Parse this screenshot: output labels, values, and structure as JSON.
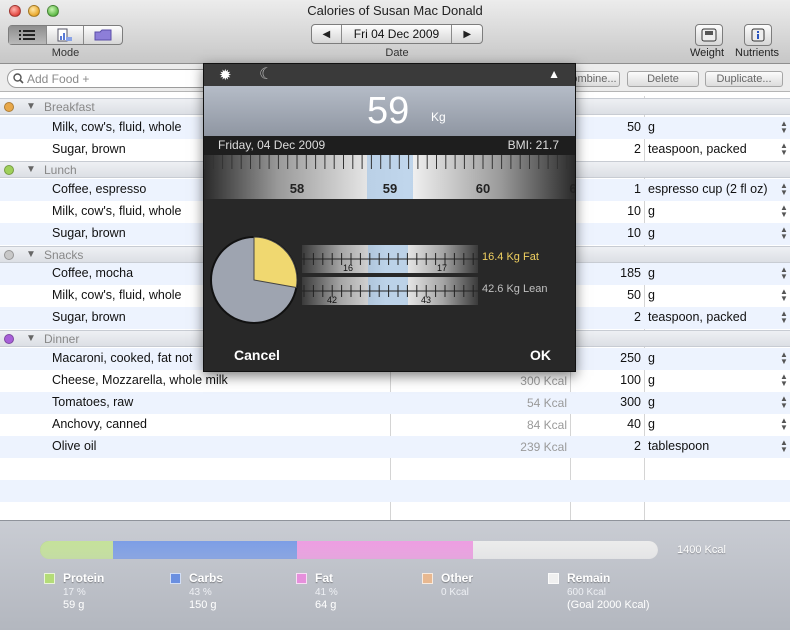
{
  "window": {
    "title": "Calories of Susan Mac Donald"
  },
  "toolbar": {
    "mode_label": "Mode",
    "mode_icons": [
      "list-icon",
      "chart-icon",
      "folder-icon"
    ],
    "date_value": "Fri 04 Dec 2009",
    "date_label": "Date",
    "prev_arrow": "◀",
    "next_arrow": "▶",
    "weight_label": "Weight",
    "nutrients_label": "Nutrients"
  },
  "search": {
    "placeholder": "Add Food +",
    "combine_label": "Combine...",
    "delete_label": "Delete",
    "duplicate_label": "Duplicate..."
  },
  "groups": [
    {
      "name": "Breakfast",
      "color": "#e8a84a"
    },
    {
      "name": "Lunch",
      "color": "#9fd05a"
    },
    {
      "name": "Snacks",
      "color": "#c8c8c8"
    },
    {
      "name": "Dinner",
      "color": "#a860d8"
    }
  ],
  "items": [
    {
      "name": "Milk, cow's, fluid, whole",
      "kcal": "",
      "qty": "50",
      "unit": "g"
    },
    {
      "name": "Sugar, brown",
      "kcal": "",
      "qty": "2",
      "unit": "teaspoon, packed"
    },
    {
      "name": "Coffee, espresso",
      "kcal": "",
      "qty": "1",
      "unit": "espresso cup (2 fl oz)"
    },
    {
      "name": "Milk, cow's, fluid, whole",
      "kcal": "",
      "qty": "10",
      "unit": "g"
    },
    {
      "name": "Sugar, brown",
      "kcal": "",
      "qty": "10",
      "unit": "g"
    },
    {
      "name": "Coffee, mocha",
      "kcal": "",
      "qty": "185",
      "unit": "g"
    },
    {
      "name": "Milk, cow's, fluid, whole",
      "kcal": "",
      "qty": "50",
      "unit": "g"
    },
    {
      "name": "Sugar, brown",
      "kcal": "",
      "qty": "2",
      "unit": "teaspoon, packed"
    },
    {
      "name": "Macaroni, cooked, fat not",
      "kcal": "",
      "qty": "250",
      "unit": "g"
    },
    {
      "name": "Cheese, Mozzarella, whole milk",
      "kcal": "300 Kcal",
      "qty": "100",
      "unit": "g"
    },
    {
      "name": "Tomatoes, raw",
      "kcal": "54 Kcal",
      "qty": "300",
      "unit": "g"
    },
    {
      "name": "Anchovy, canned",
      "kcal": "84 Kcal",
      "qty": "40",
      "unit": "g"
    },
    {
      "name": "Olive oil",
      "kcal": "239 Kcal",
      "qty": "2",
      "unit": "tablespoon"
    }
  ],
  "summary": {
    "total": "1400 Kcal",
    "segments": [
      {
        "name": "protein",
        "fraction": 0.17,
        "color": "#c5e29a"
      },
      {
        "name": "carbs",
        "fraction": 0.43,
        "color": "#7d9ee6"
      },
      {
        "name": "fat",
        "fraction": 0.41,
        "color": "#ee9ee2"
      },
      {
        "name": "remain",
        "fraction": 0.43,
        "color": "#ececec"
      }
    ],
    "protein": {
      "name": "Protein",
      "pct": "17 %",
      "val": "59 g",
      "color": "#b4dc78"
    },
    "carbs": {
      "name": "Carbs",
      "pct": "43 %",
      "val": "150 g",
      "color": "#6a8fe0"
    },
    "fat": {
      "name": "Fat",
      "pct": "41 %",
      "val": "64 g",
      "color": "#e690dc"
    },
    "other": {
      "name": "Other",
      "val": "0 Kcal",
      "color": "#e8b890"
    },
    "remain": {
      "name": "Remain",
      "val": "600 Kcal",
      "goal": "(Goal 2000 Kcal)",
      "color": "#f0f0f0"
    }
  },
  "weight_popover": {
    "value": "59",
    "unit": "Kg",
    "date": "Friday, 04 Dec 2009",
    "bmi": "BMI: 21.7",
    "scale_labels": [
      "58",
      "59",
      "60",
      "6"
    ],
    "fat_scale_labels": [
      "16",
      "17"
    ],
    "lean_scale_labels": [
      "42",
      "43"
    ],
    "fat_label": "16.4 Kg Fat",
    "lean_label": "42.6 Kg Lean",
    "fat_fraction": 0.278,
    "fat_color": "#f0d870",
    "lean_color": "#9ea4b0",
    "cancel_label": "Cancel",
    "ok_label": "OK"
  }
}
